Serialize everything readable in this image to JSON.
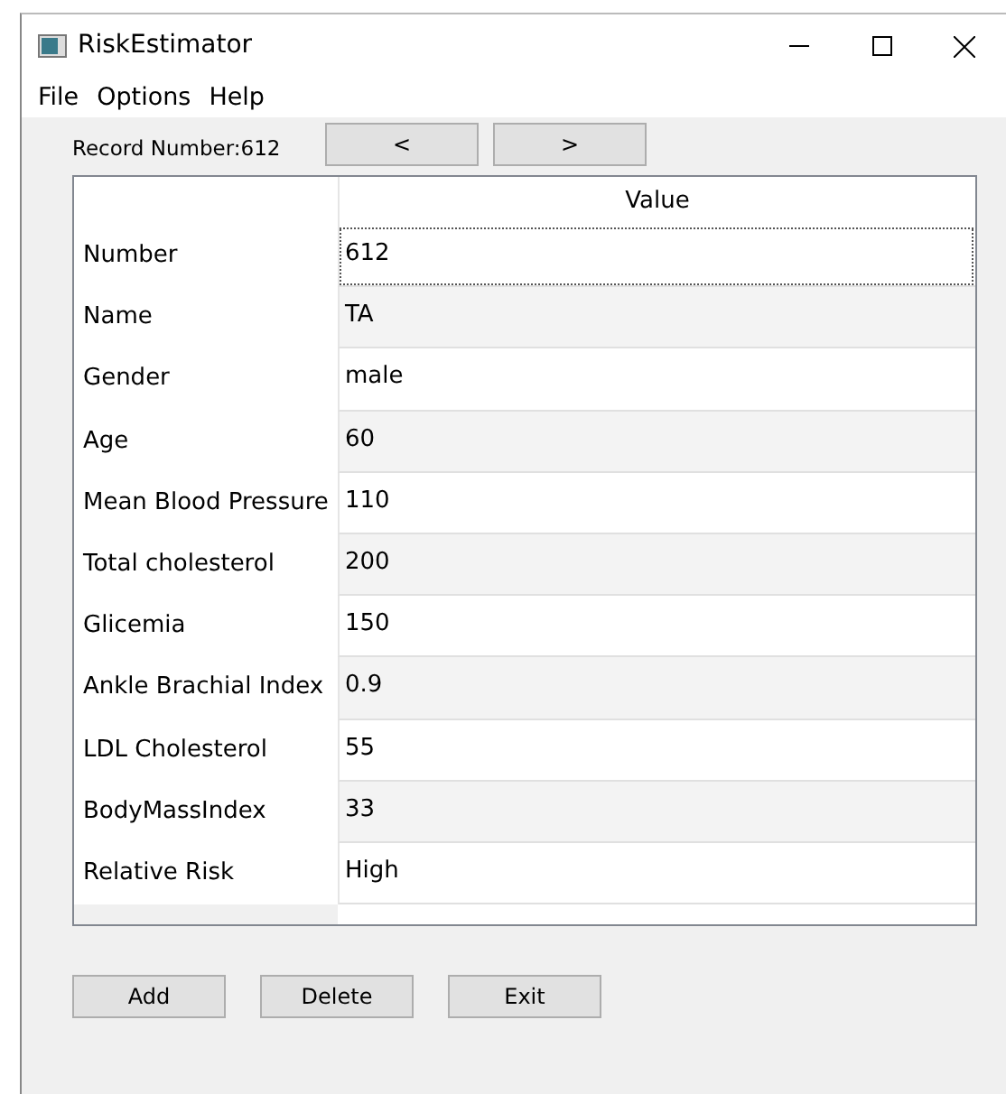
{
  "window": {
    "title": "RiskEstimator"
  },
  "menu": [
    "File",
    "Options",
    "Help"
  ],
  "record_label": "Record Number:612",
  "nav_buttons": [
    "<",
    ">"
  ],
  "table": {
    "column": "Value",
    "rows": [
      {
        "label": "Number",
        "value": "612",
        "focused": true
      },
      {
        "label": "Name",
        "value": "TA",
        "focused": false
      },
      {
        "label": "Gender",
        "value": "male",
        "focused": false
      },
      {
        "label": "Age",
        "value": "60",
        "focused": false
      },
      {
        "label": "Mean Blood Pressure",
        "value": "110",
        "focused": false
      },
      {
        "label": "Total cholesterol",
        "value": "200",
        "focused": false
      },
      {
        "label": "Glicemia",
        "value": "150",
        "focused": false
      },
      {
        "label": "Ankle Brachial Index",
        "value": "0.9",
        "focused": false
      },
      {
        "label": "LDL Cholesterol",
        "value": "55",
        "focused": false
      },
      {
        "label": "BodyMassIndex",
        "value": "33",
        "focused": false
      },
      {
        "label": "Relative Risk",
        "value": "High",
        "focused": false
      }
    ]
  },
  "buttons": [
    "Add",
    "Delete",
    "Exit"
  ]
}
